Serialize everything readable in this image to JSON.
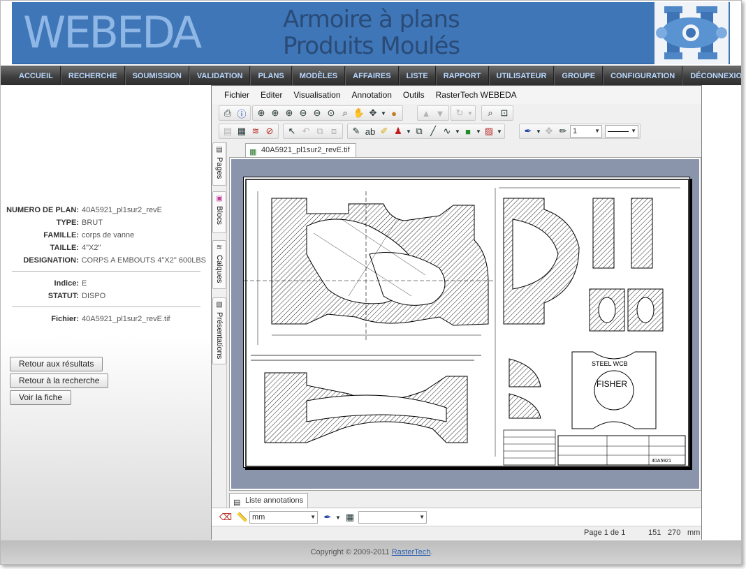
{
  "header": {
    "brand": "WEBEDA",
    "title_line1": "Armoire à plans",
    "title_line2": "Produits Moulés"
  },
  "menu": [
    "ACCUEIL",
    "RECHERCHE",
    "SOUMISSION",
    "VALIDATION",
    "PLANS",
    "MODÈLES",
    "AFFAIRES",
    "LISTE",
    "RAPPORT",
    "UTILISATEUR",
    "GROUPE",
    "CONFIGURATION",
    "DÉCONNEXION"
  ],
  "details": {
    "numero_label": "NUMERO DE PLAN:",
    "numero": "40A5921_pl1sur2_revE",
    "type_label": "TYPE:",
    "type": "BRUT",
    "famille_label": "FAMILLE:",
    "famille": "corps de vanne",
    "taille_label": "TAILLE:",
    "taille": "4\"X2\"",
    "designation_label": "DESIGNATION:",
    "designation": "CORPS A EMBOUTS 4\"X2\" 600LBS",
    "indice_label": "Indice:",
    "indice": "E",
    "statut_label": "STATUT:",
    "statut": "DISPO",
    "fichier_label": "Fichier:",
    "fichier": "40A5921_pl1sur2_revE.tif"
  },
  "buttons": {
    "back_results": "Retour aux résultats",
    "back_search": "Retour à la recherche",
    "view_sheet": "Voir la fiche"
  },
  "viewer": {
    "menu": [
      "Fichier",
      "Editer",
      "Visualisation",
      "Annotation",
      "Outils",
      "RasterTech WEBEDA"
    ],
    "line_width": "1",
    "side_tabs": [
      "Pages",
      "Blocs",
      "Calques",
      "Présentations"
    ],
    "document_tab": "40A5921_pl1sur2_revE.tif",
    "annotations_tab": "Liste annotations",
    "unit_select": "mm",
    "status": {
      "page": "Page 1 de 1",
      "x": "151",
      "y": "270",
      "unit": "mm"
    },
    "drawing_text": {
      "steel": "STEEL WCB",
      "fisher": "FISHER",
      "ref": "40A5921"
    }
  },
  "footer": {
    "copyright": "Copyright © 2009-2011",
    "company": "RasterTech",
    "period": "."
  }
}
